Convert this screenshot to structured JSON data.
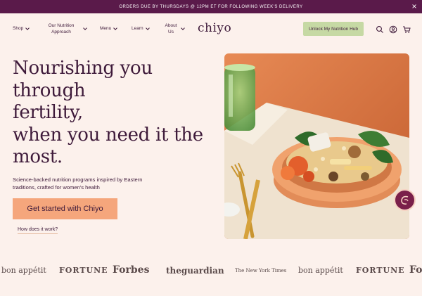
{
  "announcement": {
    "text": "ORDERS DUE BY THURSDAYS @ 12PM ET FOR FOLLOWING WEEK'S DELIVERY",
    "close_icon": "close-icon"
  },
  "nav": {
    "items": [
      {
        "label": "Shop"
      },
      {
        "label": "Our Nutrition Approach"
      },
      {
        "label": "Menu"
      },
      {
        "label": "Learn"
      },
      {
        "label": "About Us"
      }
    ],
    "logo": "chiyo",
    "hub_button": "Unlock My Nutrition Hub",
    "icons": [
      "search-icon",
      "account-icon",
      "cart-icon"
    ]
  },
  "hero": {
    "title_lines": [
      "Nourishing you",
      "through",
      "fertility,",
      "when you need it the",
      "most."
    ],
    "subtitle": "Science-backed nutrition programs inspired by Eastern traditions, crafted for women's health",
    "cta": "Get started with Chiyo",
    "secondary_link": "How does it work?"
  },
  "press": [
    "bon appétit",
    "FORTUNE",
    "Forbes",
    "theguardian",
    "The New York Times",
    "bon appétit",
    "FORTUNE",
    "Fo"
  ],
  "colors": {
    "announcement_bg": "#5a1a4a",
    "page_bg": "#fcf1ec",
    "hub_button": "#c6d9a4",
    "cta": "#f5a67c",
    "text": "#3e1a3a"
  }
}
